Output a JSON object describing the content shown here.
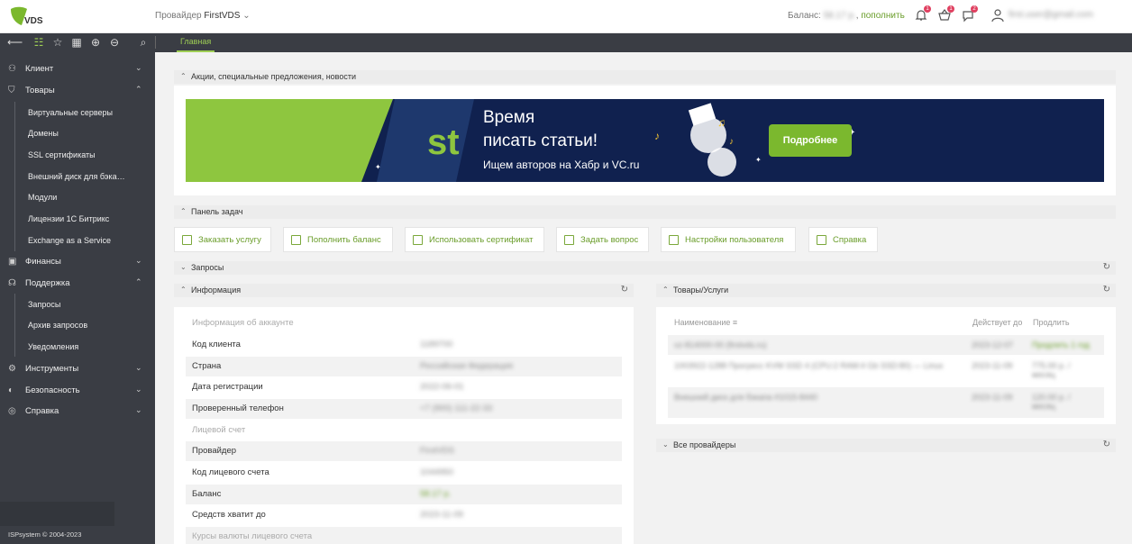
{
  "header": {
    "provider_prefix": "Провайдер",
    "provider_name": "FirstVDS",
    "balance_label": "Баланс:",
    "balance_value": "58.17 р.",
    "topup": "пополнить",
    "user_email": "first.user@gmail.com",
    "badges": [
      "1",
      "1",
      "2"
    ],
    "accent": "#6a9d2a"
  },
  "toolbar": {
    "tab_main": "Главная"
  },
  "sidebar": {
    "items": [
      {
        "label": "Клиент"
      },
      {
        "label": "Товары"
      },
      {
        "label": "Финансы"
      },
      {
        "label": "Поддержка"
      },
      {
        "label": "Инструменты"
      },
      {
        "label": "Безопасность"
      },
      {
        "label": "Справка"
      }
    ],
    "goods_sub": [
      "Виртуальные серверы",
      "Домены",
      "SSL сертификаты",
      "Внешний диск для бэка…",
      "Модули",
      "Лицензии 1С Битрикс",
      "Exchange as a Service"
    ],
    "support_sub": [
      "Запросы",
      "Архив запросов",
      "Уведомления"
    ],
    "copyright": "ISPsystem © 2004-2023"
  },
  "main": {
    "promo_title": "Акции, специальные предложения, новости",
    "banner": {
      "line1": "Время",
      "line2": "писать статьи!",
      "line3": "Ищем авторов на Хабр и VC.ru",
      "button": "Подробнее",
      "logo": "st"
    },
    "tasks_title": "Панель задач",
    "tasks": [
      "Заказать услугу",
      "Пополнить баланс",
      "Использовать сертификат",
      "Задать вопрос",
      "Настройки пользователя",
      "Справка"
    ],
    "requests_title": "Запросы",
    "info_title": "Информация",
    "goods_title": "Товары/Услуги",
    "providers_title": "Все провайдеры",
    "info": {
      "group1": "Информация об аккаунте",
      "rows1": [
        {
          "k": "Код клиента",
          "v": "1189700"
        },
        {
          "k": "Страна",
          "v": "Российская Федерация"
        },
        {
          "k": "Дата регистрации",
          "v": "2022-06-01"
        },
        {
          "k": "Проверенный телефон",
          "v": "+7 (900) 111-22-33"
        }
      ],
      "group2": "Лицевой счет",
      "rows2": [
        {
          "k": "Провайдер",
          "v": "FirstVDS"
        },
        {
          "k": "Код лицевого счета",
          "v": "1044950"
        },
        {
          "k": "Баланс",
          "v": "58.17 р."
        },
        {
          "k": "Средств хватит до",
          "v": "2023-11-09"
        }
      ],
      "group3": "Курсы валюты лицевого счета"
    },
    "goods": {
      "headers": [
        "Наименование",
        "Действует до",
        "Продлить"
      ],
      "rows": [
        {
          "name": "vz-814000-00 (firstvds.ru)",
          "date": "2023-12-07",
          "price": "Продлить 1 год"
        },
        {
          "name": "1003922-1288 Прогресс KVM SSD 4 (CPU:2 RAM:4 Gb SSD:80) — Linux",
          "date": "2023-11-09",
          "price": "775.00 р. / месяц"
        },
        {
          "name": "Внешний диск для бэкапа #1015-8440",
          "date": "2023-11-09",
          "price": "120.00 р. / месяц"
        }
      ]
    }
  }
}
